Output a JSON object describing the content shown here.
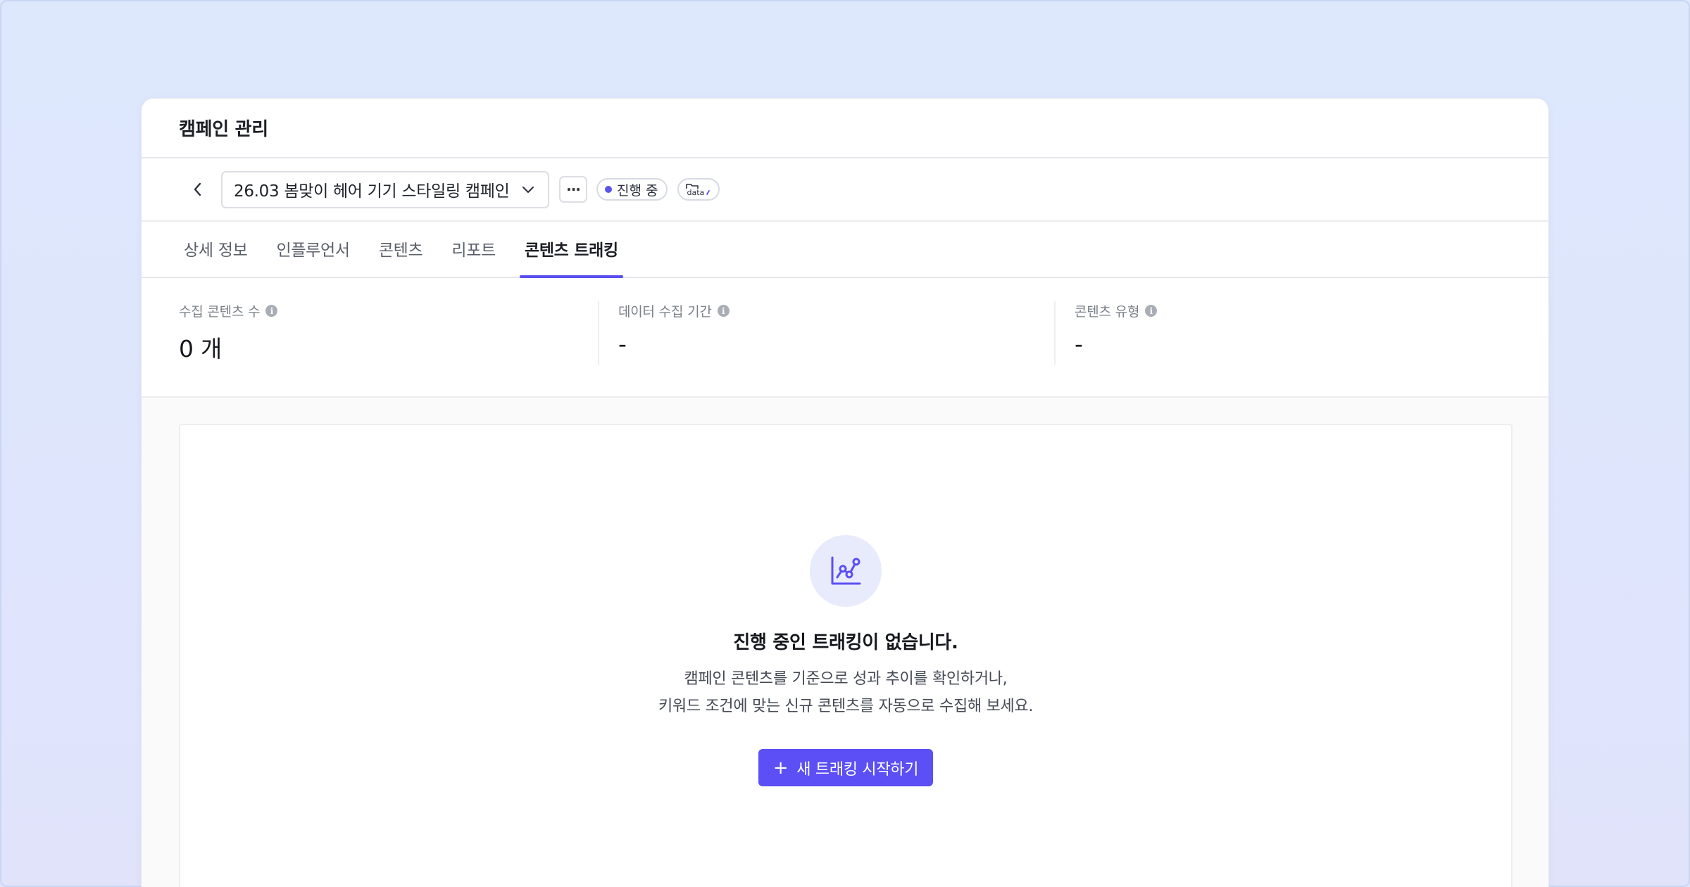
{
  "header": {
    "title": "캠페인 관리"
  },
  "campaign": {
    "selected": "26.03 봄맞이 헤어 기기 스타일링 캠페인",
    "more_label": "···",
    "status": "진행 중",
    "status_color": "#5b52f0",
    "data_badge_label": "data"
  },
  "tabs": [
    {
      "label": "상세 정보",
      "active": false
    },
    {
      "label": "인플루언서",
      "active": false
    },
    {
      "label": "콘텐츠",
      "active": false
    },
    {
      "label": "리포트",
      "active": false
    },
    {
      "label": "콘텐츠 트래킹",
      "active": true
    }
  ],
  "stats": [
    {
      "label": "수집 콘텐츠 수",
      "value": "0 개"
    },
    {
      "label": "데이터 수집 기간",
      "value": "-"
    },
    {
      "label": "콘텐츠 유형",
      "value": "-"
    }
  ],
  "empty_state": {
    "icon": "chart-line-icon",
    "title": "진행 중인 트래킹이 없습니다.",
    "desc_line1": "캠페인 콘텐츠를 기준으로 성과 추이를 확인하거나,",
    "desc_line2": "키워드 조건에 맞는 신규 콘텐츠를 자동으로 수집해 보세요.",
    "button_plus": "+",
    "button_label": "새 트래킹 시작하기",
    "accent_color": "#5b4ff5"
  }
}
